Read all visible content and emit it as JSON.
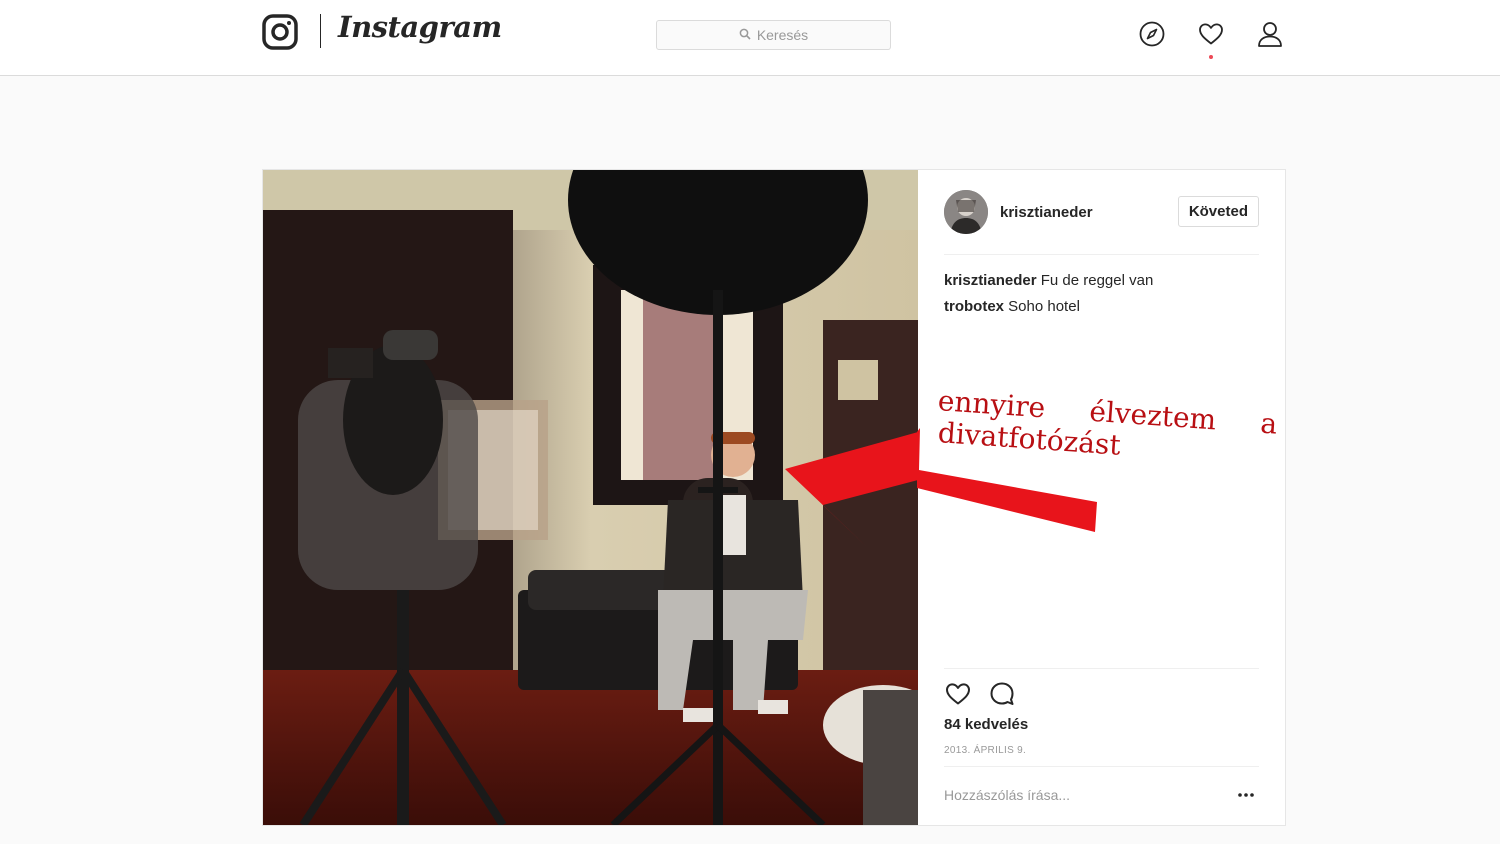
{
  "header": {
    "brand": "Instagram",
    "search_placeholder": "Keresés",
    "icons": [
      "instagram-glyph-icon",
      "compass-icon",
      "heart-icon",
      "profile-icon"
    ],
    "notification_dot_color": "#ed4956"
  },
  "post": {
    "author": "krisztianeder",
    "follow_label": "Követed",
    "comments": [
      {
        "user": "krisztianeder",
        "text": "Fu de reggel van"
      },
      {
        "user": "trobotex",
        "text": "Soho hotel"
      }
    ],
    "annotation": {
      "words_line1": [
        "ennyire",
        "élveztem",
        "a"
      ],
      "line2": "divatfotózást",
      "color": "#b80f13",
      "arrow_color": "#e8141b"
    },
    "likes": "84 kedvelés",
    "date": "2013. ÁPRILIS 9.",
    "comment_placeholder": "Hozzászólás írása...",
    "more_icon": "ellipsis-icon"
  }
}
